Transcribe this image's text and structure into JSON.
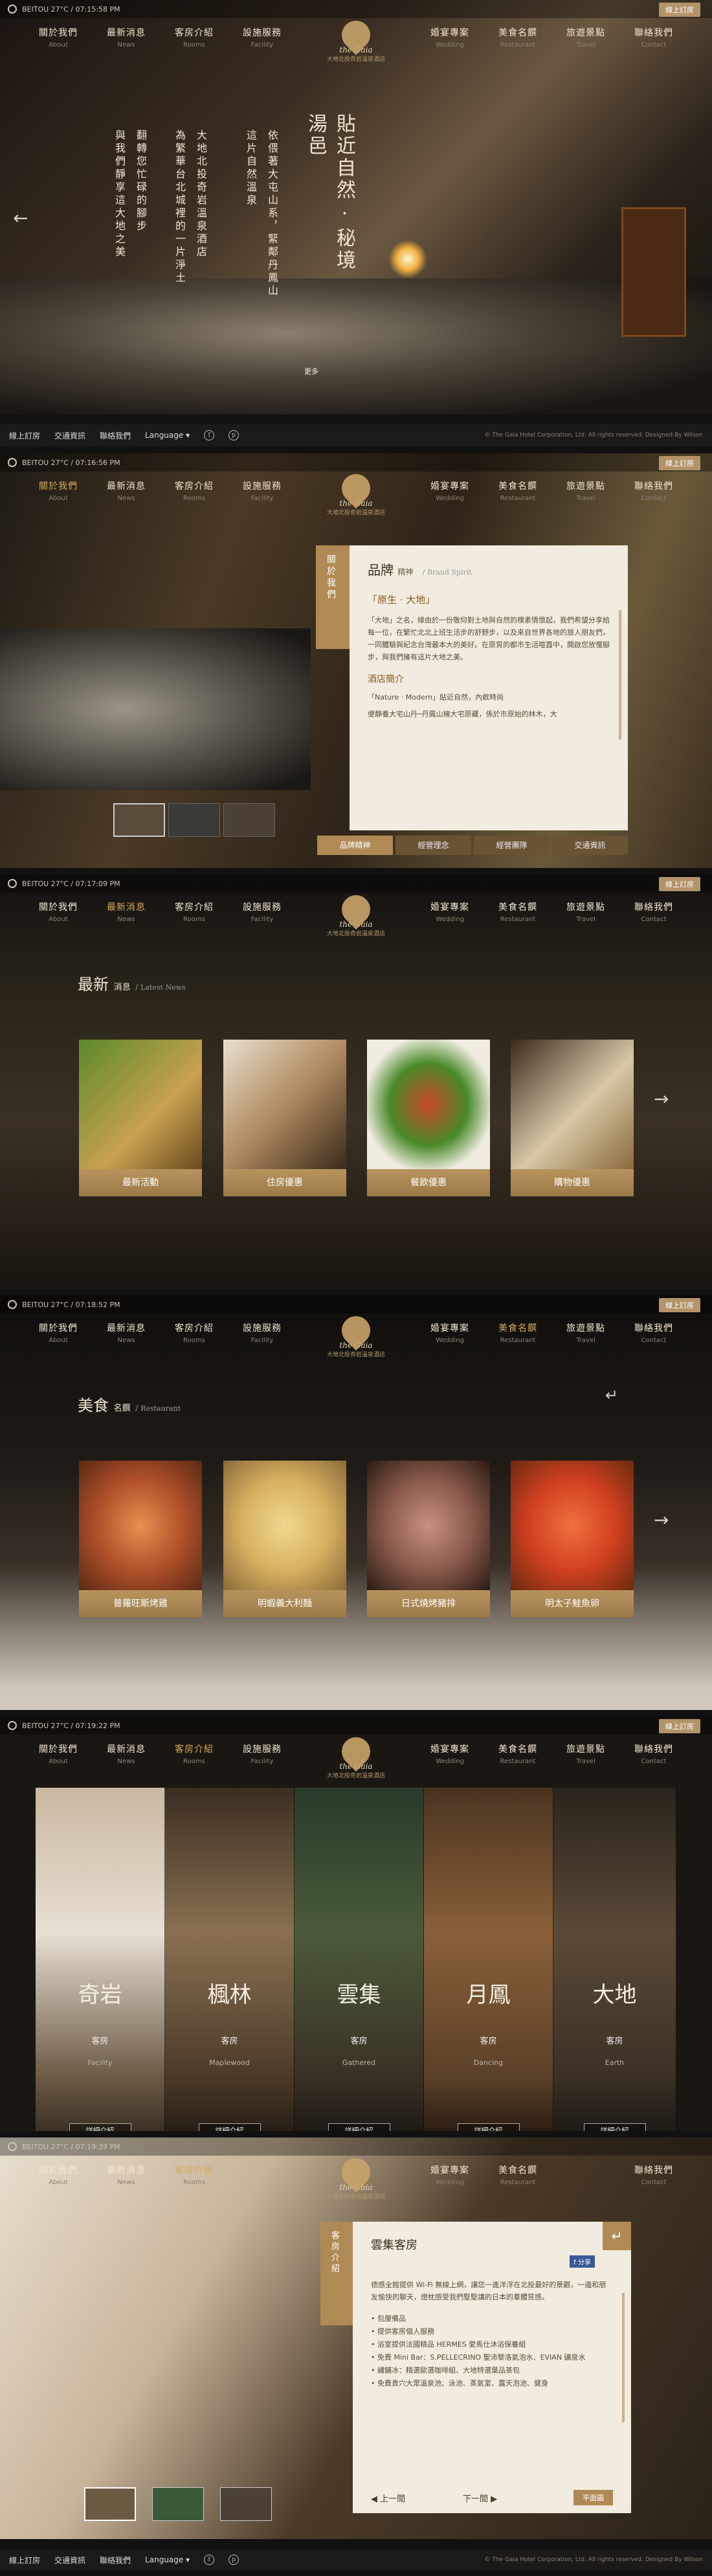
{
  "common": {
    "weather_icon": "sun-icon",
    "book_label": "線上訂房",
    "language_label": "Language",
    "copyright": "© The Gaia Hotel Corporation, Ltd. All rights reserved. Designed By ",
    "designer": "Wilson",
    "logo_name": "the Gaia",
    "logo_sub": "大地北投奇岩溫泉酒店",
    "nav": [
      {
        "zh": "關於我們",
        "en": "About"
      },
      {
        "zh": "最新消息",
        "en": "News"
      },
      {
        "zh": "客房介紹",
        "en": "Rooms"
      },
      {
        "zh": "設施服務",
        "en": "Facility"
      },
      {
        "zh": "婚宴專案",
        "en": "Wedding"
      },
      {
        "zh": "美食名饌",
        "en": "Restaurant"
      },
      {
        "zh": "旅遊景點",
        "en": "Travel"
      },
      {
        "zh": "聯絡我們",
        "en": "Contact"
      }
    ],
    "footer_links": [
      "線上訂房",
      "交通資訊",
      "聯絡我們"
    ],
    "colors": {
      "accent": "#b3936a",
      "gold": "#d7a95b",
      "dark": "#1b1a18"
    }
  },
  "sec1": {
    "status": "BEITOU 27°C / 07:15:58 PM",
    "title": "貼近自然 · 秘境湯邑",
    "col1": "依偎著大屯山系，緊鄰丹鳳山",
    "col2": "這片自然溫泉",
    "col3": "大地北投奇岩溫泉酒店",
    "col4": "為繁華台北城裡的一片淨土",
    "col5": "翻轉您忙碌的腳步",
    "col6": "與我們靜享這大地之美",
    "more": "更多"
  },
  "sec2": {
    "status": "BEITOU 27°C / 07:16:56 PM",
    "side_label": "關於我們",
    "title": "品牌",
    "title_sub": "精神",
    "title_en": "Brand Spirit",
    "quote": "「原生 · 大地」",
    "p1": "「大地」之名，緣由於一份敬仰對土地與自然的樸素情懷起，我們希望分享給每一位，在繁忙北北上班生活步的舒野步，以及來自世界各地的旅人朋友們，一同體驗與紀念台灣最本大的美好。在原質的都市生活喧囂中，開啟您放慢腳步，與我們擁有這片大地之美。",
    "subtitle": "酒店簡介",
    "p2": "「Nature · Modern」貼近自然，內斂時尚",
    "p3": "便靜養大宅山丹─丹鳳山擁大宅原藏，係於市原始的林木，大",
    "tabs": [
      "品牌精神",
      "經營理念",
      "經營團隊",
      "交通資訊"
    ]
  },
  "sec3": {
    "status": "BEITOU 27°C / 07:17:09 PM",
    "title": "最新",
    "title_sub": "消息",
    "title_en": "Latest News",
    "cards": [
      "最新活動",
      "住房優惠",
      "餐飲優惠",
      "購物優惠"
    ]
  },
  "sec4": {
    "status": "BEITOU 27°C / 07:18:52 PM",
    "title": "美食",
    "title_sub": "名饌",
    "title_en": "Restaurant",
    "cards": [
      "普羅旺斯烤雞",
      "明蝦義大利麵",
      "日式燒烤豬排",
      "明太子鮭魚卵"
    ]
  },
  "sec5": {
    "status": "BEITOU 27°C / 07:19:22 PM",
    "rooms": [
      {
        "big": "奇岩",
        "small": "客房",
        "en": "Facility",
        "btn": "詳細介紹"
      },
      {
        "big": "楓林",
        "small": "客房",
        "en": "Maplewood",
        "btn": "詳細介紹"
      },
      {
        "big": "雲集",
        "small": "客房",
        "en": "Gathered",
        "btn": "詳細介紹"
      },
      {
        "big": "月鳳",
        "small": "客房",
        "en": "Dancing",
        "btn": "詳細介紹"
      },
      {
        "big": "大地",
        "small": "客房",
        "en": "Earth",
        "btn": "詳細介紹"
      }
    ]
  },
  "sec6": {
    "status": "BEITOU 27°C / 07:19:39 PM",
    "side_label": "客房介紹",
    "title": "雲集客房",
    "share_fb": "f 分享",
    "intro": "德感全館提供 Wi-Fi 無線上網，讓您一進洋浮在北投最好的景觀，一邊和朋友愉快的聊天，燈枕感受我們堅堅講的日本的羣體質感。",
    "bullets": [
      "• 包厘備品",
      "• 提供客房個人服務",
      "• 浴室提供法國精品 HERMES 愛馬仕沐浴保養組",
      "• 免費 Mini Bar：S.PELLECRINO 聖沛黎洛氣泡水、EVIAN 礦泉水",
      "• 繡舖冰：精選歐選咖啡組、大地特選葉品茶包",
      "• 免費貴穴大眾溫泉池、泳池、蒸氣室、露天泡池、健身"
    ],
    "prev": "上一間",
    "next": "下一間",
    "booking": "平面圖"
  }
}
